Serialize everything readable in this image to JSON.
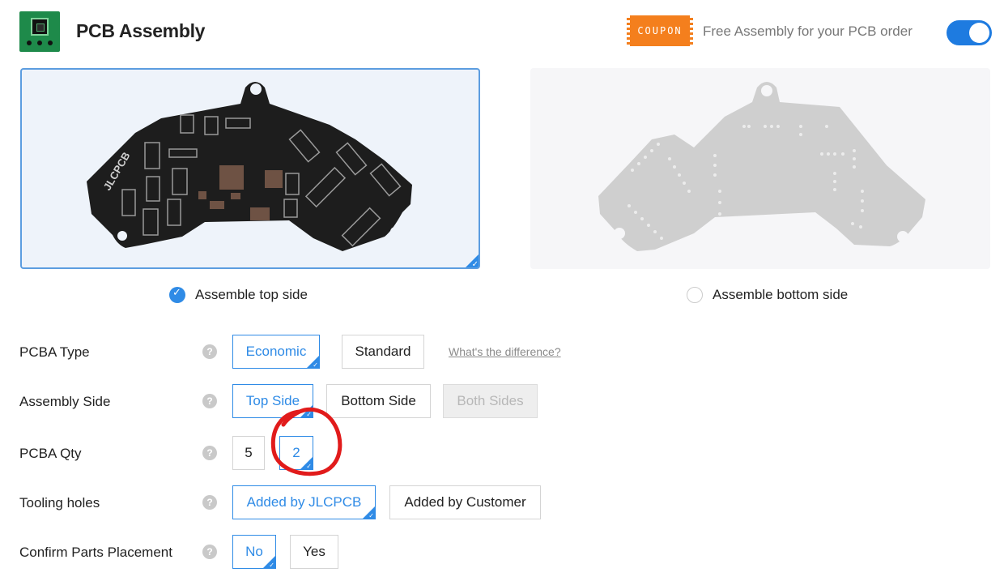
{
  "header": {
    "title": "PCB Assembly",
    "coupon_label": "COUPON",
    "coupon_text": "Free Assembly for your PCB order",
    "toggle_state": "on"
  },
  "assemble_sides": [
    {
      "label": "Assemble top side",
      "checked": true
    },
    {
      "label": "Assemble bottom side",
      "checked": false
    }
  ],
  "board_silkscreen": "JLCPCB",
  "form": {
    "pcba_type": {
      "label": "PCBA Type",
      "options": [
        "Economic",
        "Standard"
      ],
      "selected": "Economic",
      "link": "What's the difference?"
    },
    "assembly_side": {
      "label": "Assembly Side",
      "options": [
        "Top Side",
        "Bottom Side",
        "Both Sides"
      ],
      "selected": "Top Side",
      "disabled": [
        "Both Sides"
      ]
    },
    "pcba_qty": {
      "label": "PCBA Qty",
      "options": [
        "5",
        "2"
      ],
      "selected": "2"
    },
    "tooling_holes": {
      "label": "Tooling holes",
      "options": [
        "Added by JLCPCB",
        "Added by Customer"
      ],
      "selected": "Added by JLCPCB"
    },
    "confirm_parts": {
      "label": "Confirm Parts Placement",
      "options": [
        "No",
        "Yes"
      ],
      "selected": "No"
    },
    "help_icon": "?"
  },
  "colors": {
    "accent": "#2f8be6",
    "coupon": "#f47f1d",
    "logo": "#1e8a4a",
    "annotation": "#e11b1b"
  }
}
